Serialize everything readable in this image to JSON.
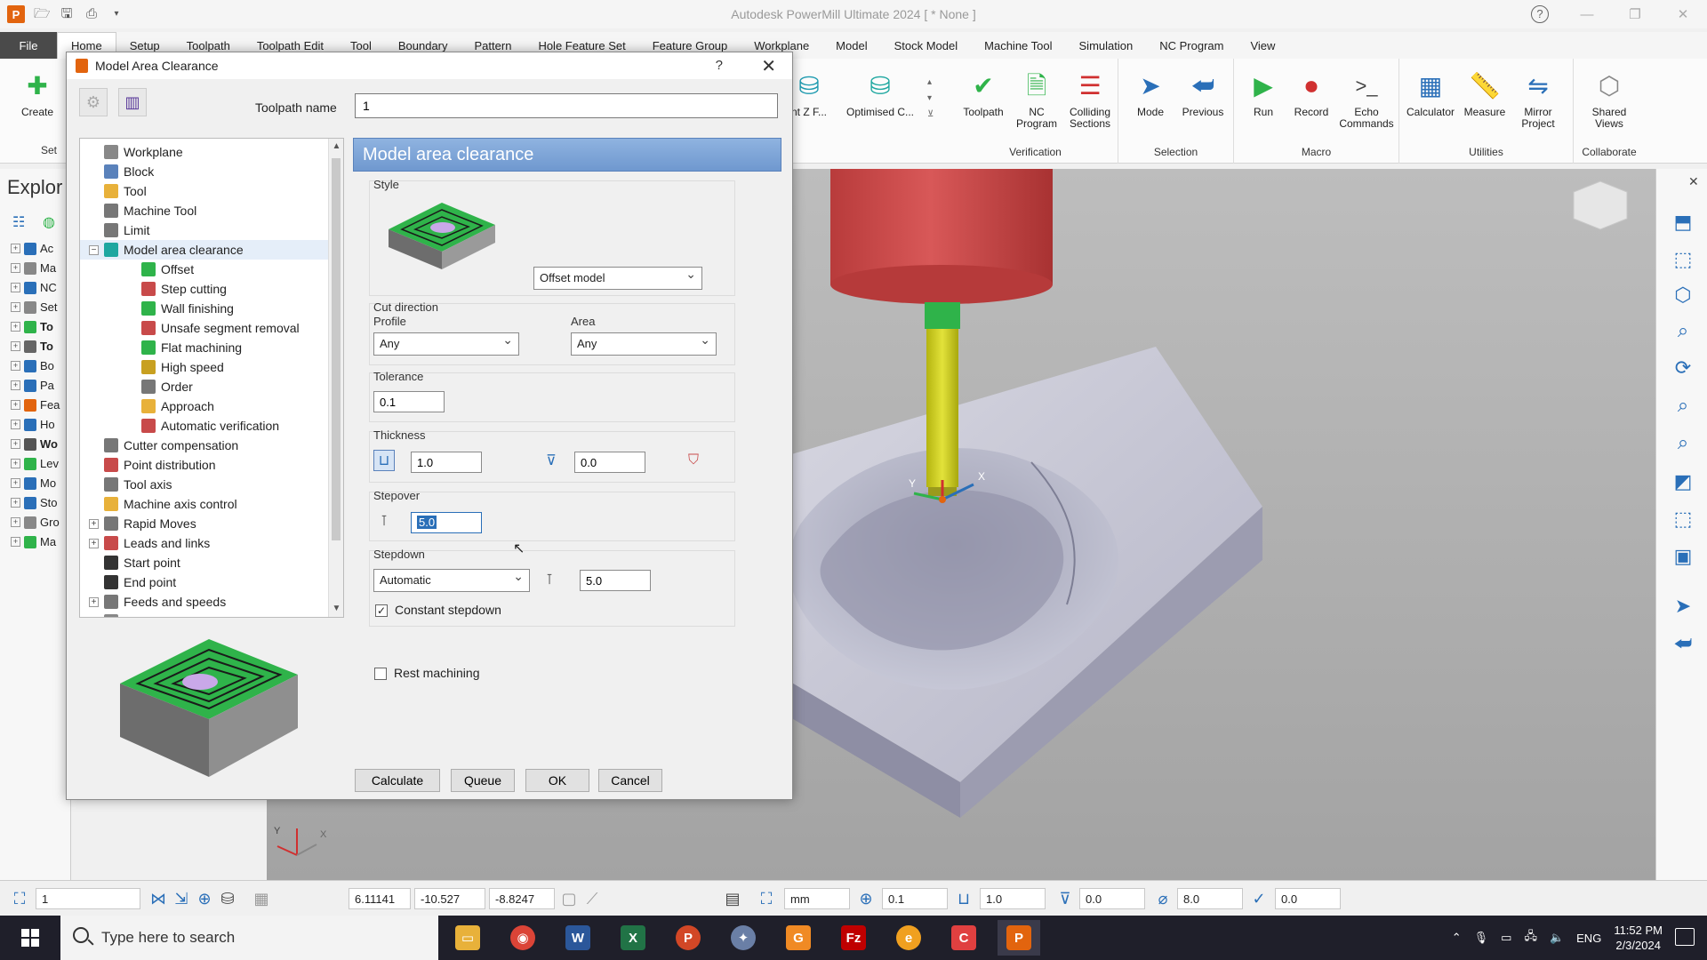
{
  "window": {
    "title": "Autodesk PowerMill Ultimate 2024   [ * None ]"
  },
  "ribbon": {
    "file_tab": "File",
    "tabs": [
      "Home",
      "Setup",
      "Toolpath",
      "Toolpath Edit",
      "Tool",
      "Boundary",
      "Pattern",
      "Hole Feature Set",
      "Feature Group",
      "Workplane",
      "Model",
      "Stock Model",
      "Machine Tool",
      "Simulation",
      "NC Program",
      "View"
    ],
    "create_label": "Create",
    "setup_group_label": "Set",
    "partial_button_1": "nt Z F...",
    "partial_button_2": "Optimised C...",
    "verification": {
      "label": "Verification",
      "buttons": [
        "Toolpath",
        "NC Program",
        "Colliding Sections"
      ]
    },
    "selection": {
      "label": "Selection",
      "buttons": [
        "Mode",
        "Previous"
      ]
    },
    "macro": {
      "label": "Macro",
      "buttons": [
        "Run",
        "Record",
        "Echo Commands"
      ]
    },
    "utilities": {
      "label": "Utilities",
      "buttons": [
        "Calculator",
        "Measure",
        "Mirror Project"
      ]
    },
    "collaborate": {
      "label": "Collaborate",
      "buttons": [
        "Shared Views"
      ]
    }
  },
  "explorer": {
    "title": "Explor",
    "items": [
      "Ac",
      "Ma",
      "NC",
      "Set",
      "To",
      "To",
      "Bo",
      "Pa",
      "Fea",
      "Ho",
      "Wo",
      "Lev",
      "Mo",
      "Sto",
      "Gro",
      "Ma"
    ]
  },
  "dialog": {
    "title": "Model Area Clearance",
    "help": "?",
    "toolpath_name_label": "Toolpath name",
    "toolpath_name_value": "1",
    "tree": [
      {
        "label": "Workplane",
        "indent": 0
      },
      {
        "label": "Block",
        "indent": 0
      },
      {
        "label": "Tool",
        "indent": 0
      },
      {
        "label": "Machine Tool",
        "indent": 0
      },
      {
        "label": "Limit",
        "indent": 0
      },
      {
        "label": "Model area clearance",
        "indent": 0
      },
      {
        "label": "Offset",
        "indent": 1
      },
      {
        "label": "Step cutting",
        "indent": 1
      },
      {
        "label": "Wall finishing",
        "indent": 1
      },
      {
        "label": "Unsafe segment removal",
        "indent": 1
      },
      {
        "label": "Flat machining",
        "indent": 1
      },
      {
        "label": "High speed",
        "indent": 1
      },
      {
        "label": "Order",
        "indent": 1
      },
      {
        "label": "Approach",
        "indent": 1
      },
      {
        "label": "Automatic verification",
        "indent": 1
      },
      {
        "label": "Cutter compensation",
        "indent": 0
      },
      {
        "label": "Point distribution",
        "indent": 0
      },
      {
        "label": "Tool axis",
        "indent": 0
      },
      {
        "label": "Machine axis control",
        "indent": 0
      },
      {
        "label": "Rapid Moves",
        "indent": 0
      },
      {
        "label": "Leads and links",
        "indent": 0
      },
      {
        "label": "Start point",
        "indent": 0
      },
      {
        "label": "End point",
        "indent": 0
      },
      {
        "label": "Feeds and speeds",
        "indent": 0
      },
      {
        "label": "History",
        "indent": 0
      }
    ],
    "panel": {
      "header": "Model area clearance",
      "style_label": "Style",
      "style_value": "Offset model",
      "cut_direction_label": "Cut direction",
      "profile_label": "Profile",
      "profile_value": "Any",
      "area_label": "Area",
      "area_value": "Any",
      "tolerance_label": "Tolerance",
      "tolerance_value": "0.1",
      "thickness_label": "Thickness",
      "thickness_radial": "1.0",
      "thickness_axial": "0.0",
      "stepover_label": "Stepover",
      "stepover_value": "5.0",
      "stepdown_label": "Stepdown",
      "stepdown_mode": "Automatic",
      "stepdown_value": "5.0",
      "constant_stepdown_label": "Constant stepdown",
      "constant_stepdown_checked": true,
      "rest_machining_label": "Rest machining",
      "rest_machining_checked": false
    },
    "buttons": {
      "calculate": "Calculate",
      "queue": "Queue",
      "ok": "OK",
      "cancel": "Cancel"
    }
  },
  "viewport": {
    "axis_x": "X",
    "axis_y": "Y"
  },
  "statusbar": {
    "workplane": "1",
    "coord_x": "6.11141",
    "coord_y": "-10.527",
    "coord_z": "-8.8247",
    "units": "mm",
    "tolerance": "0.1",
    "thickness": "1.0",
    "axial_thickness": "0.0",
    "diameter": "8.0",
    "value": "0.0"
  },
  "taskbar": {
    "search_placeholder": "Type here to search",
    "language": "ENG",
    "time": "11:52 PM",
    "date": "2/3/2024"
  },
  "colors": {
    "accent": "#6f98cf",
    "brand": "#e2640e",
    "tool_holder": "#c84a4a",
    "tool_shank": "#c8c81e",
    "tool_tip": "#2fb34a"
  }
}
